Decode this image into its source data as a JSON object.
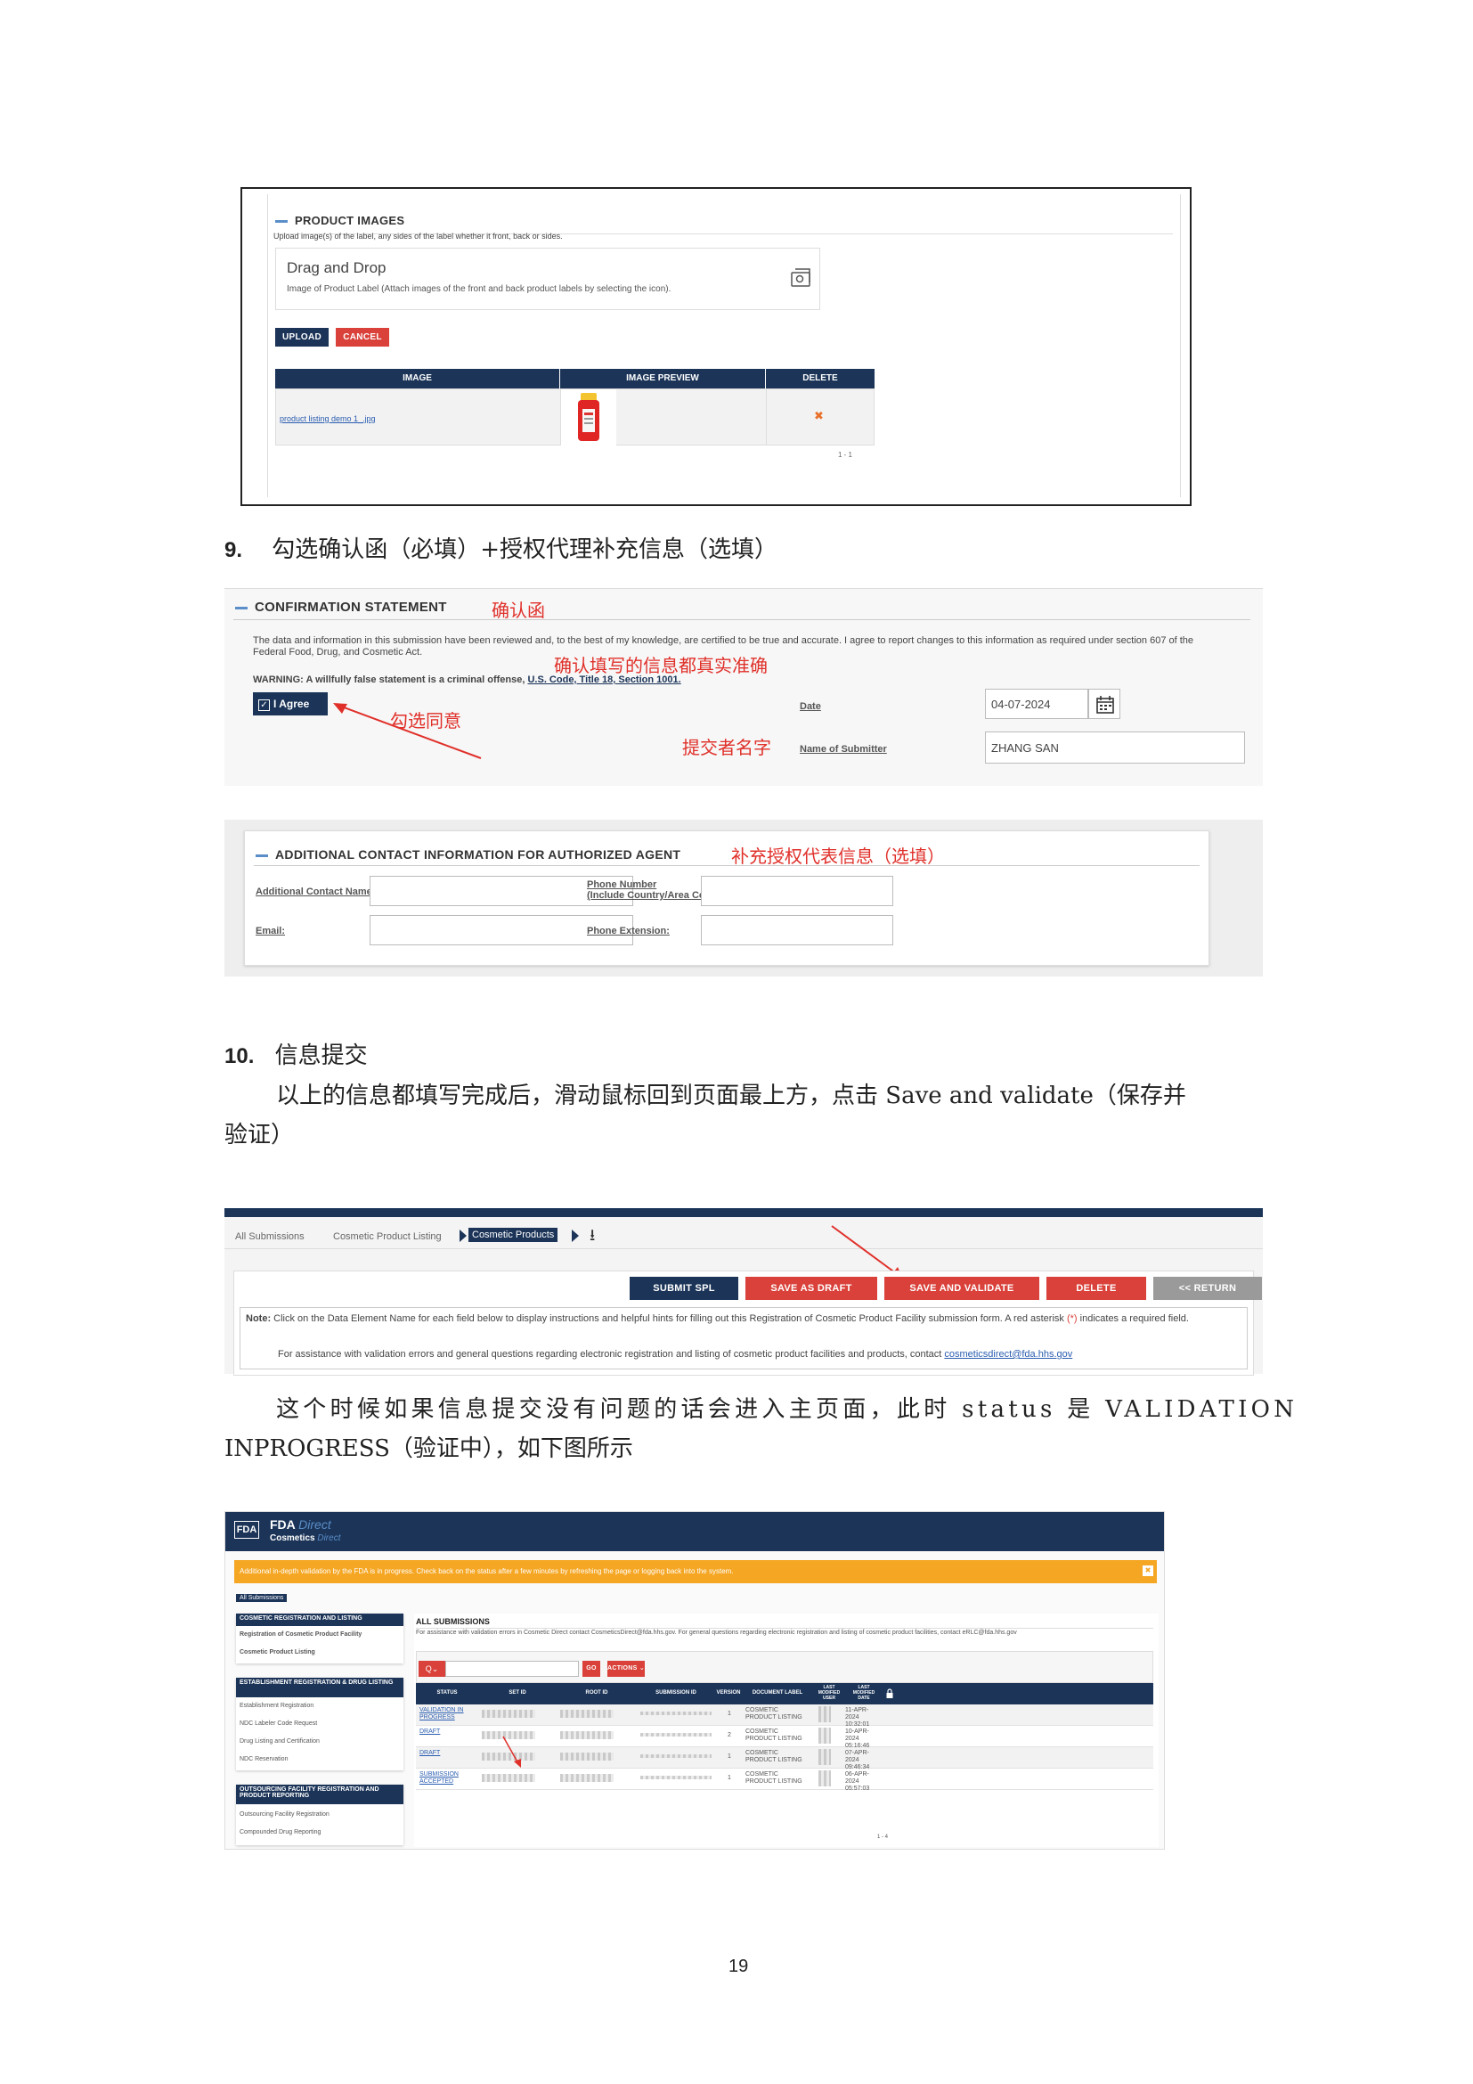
{
  "product_images": {
    "title": "PRODUCT IMAGES",
    "hint": "Upload image(s) of the label, any sides of the label whether it front, back or sides.",
    "drag_title": "Drag and Drop",
    "drag_hint": "Image of Product Label (Attach images of the front and back product labels by selecting the icon).",
    "upload_label": "UPLOAD",
    "cancel_label": "CANCEL",
    "columns": [
      "IMAGE",
      "IMAGE PREVIEW",
      "DELETE"
    ],
    "file_name": "product listing demo 1_.jpg",
    "delete_mark": "✖",
    "pager": "1 - 1"
  },
  "step9": {
    "number": "9.",
    "text": "勾选确认函（必填）+授权代理补充信息（选填）"
  },
  "confirmation": {
    "title": "CONFIRMATION STATEMENT",
    "note_title": "确认函",
    "statement": "The data and information in this submission have been reviewed and, to the best of my knowledge, are certified to be true and accurate. I agree to report changes to this information as required under section 607 of the Federal Food, Drug, and Cosmetic Act.",
    "note_true": "确认填写的信息都真实准确",
    "warning_prefix": "WARNING: A willfully false statement is a criminal offense,",
    "warning_link": "U.S. Code, Title 18, Section 1001.",
    "agree_label": "I Agree",
    "note_agree": "勾选同意",
    "date_label": "Date",
    "date_value": "04-07-2024",
    "note_submitter": "提交者名字",
    "submitter_label": "Name of Submitter",
    "submitter_value": "ZHANG SAN"
  },
  "agent": {
    "title": "ADDITIONAL CONTACT INFORMATION FOR AUTHORIZED AGENT",
    "note": "补充授权代表信息（选填）",
    "contact_label": "Additional Contact Name:",
    "phone_label_1": "Phone Number",
    "phone_label_2": "(Include Country/Area Code):",
    "email_label": "Email:",
    "ext_label": "Phone Extension:"
  },
  "step10": {
    "number": "10.",
    "heading": "信息提交",
    "text_1": "以上的信息都填写完成后，滑动鼠标回到页面最上方，点击 Save and validate（保存并",
    "text_2": "验证）"
  },
  "toolbar": {
    "breadcrumbs": [
      "All Submissions",
      "Cosmetic Product Listing",
      "Cosmetic Products"
    ],
    "download_icon": "⭳",
    "buttons": [
      "SUBMIT SPL",
      "SAVE AS DRAFT",
      "SAVE AND VALIDATE",
      "DELETE",
      "<< RETURN"
    ],
    "note_bold": "Note:",
    "note_text": "Click on the Data Element Name for each field below to display instructions and helpful hints for filling out this Registration of Cosmetic Product Facility submission form. A red asterisk",
    "note_asterisk": "(*)",
    "note_tail": "indicates a required field.",
    "assist_text": "For assistance with validation errors and general questions regarding electronic registration and listing of cosmetic product facilities and products, contact",
    "assist_email": "cosmeticsdirect@fda.hhs.gov"
  },
  "result_text": {
    "line_1": "这个时候如果信息提交没有问题的话会进入主页面，此时 status 是 VALIDATION",
    "line_2": "INPROGRESS（验证中），如下图所示"
  },
  "fda_app": {
    "logo": "FDA",
    "brand_1": "FDA",
    "brand_1b": "Direct",
    "brand_2": "Cosmetics",
    "brand_2b": "Direct",
    "banner": "Additional in-depth validation by the FDA is in progress. Check back on the status after a few minutes by refreshing the page or logging back into the system.",
    "close": "✖",
    "crumb": "All Submissions",
    "nav": [
      {
        "header": "COSMETIC REGISTRATION AND LISTING",
        "items": [
          "Registration of Cosmetic Product Facility",
          "Cosmetic Product Listing"
        ]
      },
      {
        "header": "ESTABLISHMENT REGISTRATION & DRUG LISTING",
        "items": [
          "Establishment Registration",
          "NDC Labeler Code Request",
          "Drug Listing and Certification",
          "NDC Reservation"
        ]
      },
      {
        "header": "OUTSOURCING FACILITY REGISTRATION AND PRODUCT REPORTING",
        "items": [
          "Outsourcing Facility Registration",
          "Compounded Drug Reporting"
        ]
      }
    ],
    "main_title": "ALL SUBMISSIONS",
    "main_hint": "For assistance with validation errors in Cosmetic Direct contact CosmeticsDirect@fda.hhs.gov. For general questions regarding electronic registration and listing of cosmetic product facilities, contact eRLC@fda.hhs.gov",
    "search_icon": "Q⌄",
    "go": "GO",
    "actions": "ACTIONS ⌄",
    "columns": [
      "STATUS",
      "SET ID",
      "ROOT ID",
      "SUBMISSION ID",
      "VERSION",
      "DOCUMENT LABEL",
      "LAST MODIFIED USER",
      "LAST MODIFIED DATE"
    ],
    "lock_icon": "🔒",
    "rows": [
      {
        "status": "VALIDATION IN PROGRESS",
        "version": "1",
        "label": "COSMETIC PRODUCT LISTING",
        "date": "11-APR-2024 10:32:01"
      },
      {
        "status": "DRAFT",
        "version": "2",
        "label": "COSMETIC PRODUCT LISTING",
        "date": "10-APR-2024 05:16:46"
      },
      {
        "status": "DRAFT",
        "version": "1",
        "label": "COSMETIC PRODUCT LISTING",
        "date": "07-APR-2024 09:46:34"
      },
      {
        "status": "SUBMISSION ACCEPTED",
        "version": "1",
        "label": "COSMETIC PRODUCT LISTING",
        "date": "06-APR-2024 05:57:03"
      }
    ],
    "pager": "1 - 4"
  },
  "page_number": "19",
  "colors": {
    "navy": "#1b3458",
    "red": "#d9413a",
    "accent_note": "#e0302a",
    "banner": "#f5a623"
  }
}
